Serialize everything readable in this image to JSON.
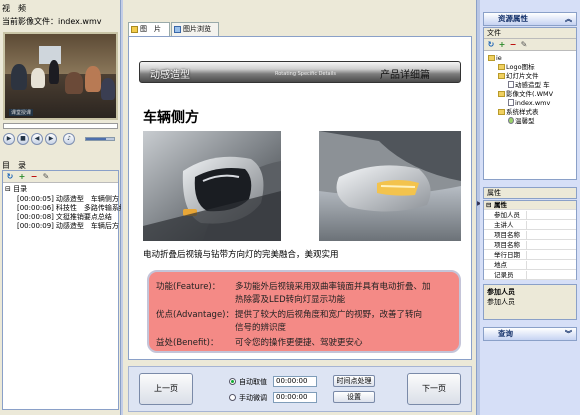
{
  "left": {
    "video_title": "视　频",
    "current_file": "当前影像文件：index.wmv",
    "video_caption": "课堂授课",
    "seek_progress": 0.0,
    "volume": 0.7,
    "toc_title": "目　录",
    "toc_root": "目录",
    "toc_items": [
      {
        "time": "[00:00:05]",
        "label": "动感造型　车辆侧方"
      },
      {
        "time": "[00:00:06]",
        "label": "科技性　多路传输系统"
      },
      {
        "time": "[00:00:08]",
        "label": "文挺推销要点总结"
      },
      {
        "time": "[00:00:09]",
        "label": "动感造型　车辆后方"
      }
    ]
  },
  "tabs": [
    {
      "label": "图　片"
    },
    {
      "label": "图片浏览"
    }
  ],
  "slide": {
    "banner_left": "动感造型",
    "banner_mid": "Rotating Specific Details",
    "banner_right": "产品详细篇",
    "heading": "车辆侧方",
    "caption": "电动折叠后视镜与钻带方向灯的完美融合，美观实用",
    "fab": [
      {
        "label": "功能(Feature)：",
        "lines": [
          "多功能外后视镜采用双曲率镜面并具有电动折叠、加",
          "热除雾及LED转向灯显示功能"
        ]
      },
      {
        "label": "优点(Advantage)：",
        "lines": [
          "提供了较大的后视角度和宽广的视野，改善了转向",
          "信号的辨识度"
        ]
      },
      {
        "label": "益处(Benefit)：",
        "lines": [
          "可令您的操作更便捷、驾驶更安心"
        ]
      }
    ]
  },
  "controls": {
    "prev": "上一页",
    "next": "下一页",
    "auto_label": "自动取值",
    "manual_label": "手动微调",
    "auto_time": "00:00:00",
    "manual_time": "00:00:00",
    "timepoint_btn": "时间点处理",
    "settings_btn": "设置"
  },
  "right": {
    "resource_title": "资源属性",
    "file_tab": "文件",
    "tree": [
      {
        "label": "ie",
        "level": 0,
        "type": "folder"
      },
      {
        "label": "Logo图标",
        "level": 1,
        "type": "folder"
      },
      {
        "label": "幻灯片文件",
        "level": 1,
        "type": "folder"
      },
      {
        "label": "动感造型 车",
        "level": 2,
        "type": "page"
      },
      {
        "label": "影像文件(.WMV",
        "level": 1,
        "type": "folder"
      },
      {
        "label": "index.wmv",
        "level": 2,
        "type": "page"
      },
      {
        "label": "系统样式表",
        "level": 1,
        "type": "folder"
      },
      {
        "label": "温馨型",
        "level": 2,
        "type": "style"
      }
    ],
    "props_title": "属性",
    "props_group": "属性",
    "props": [
      "参加人员",
      "主讲人",
      "项目名称",
      "项目名称",
      "举行日期",
      "地点",
      "记录员"
    ],
    "desc_title": "参加人员",
    "desc_text": "参加人员",
    "search_title": "查询"
  }
}
